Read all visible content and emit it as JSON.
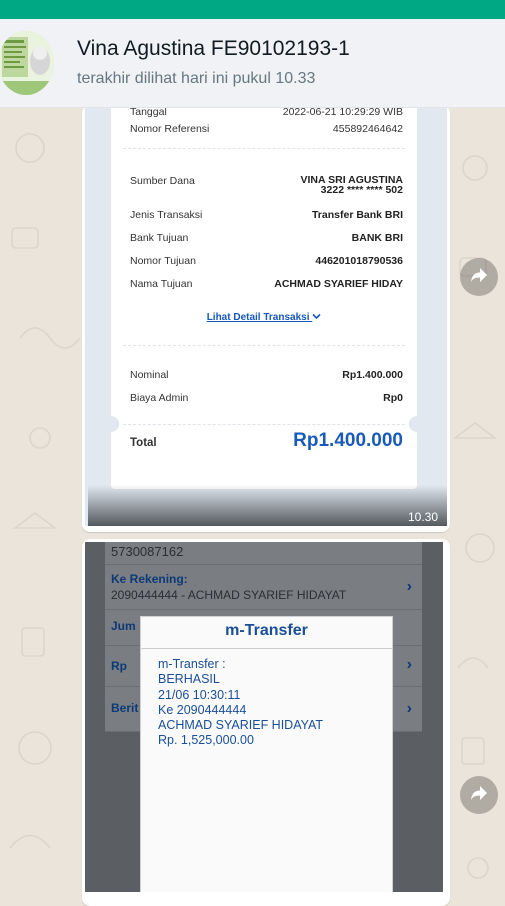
{
  "chat_header": {
    "contact_name": "Vina Agustina FE90102193-1",
    "last_seen": "terakhir dilihat hari ini pukul 10.33"
  },
  "messages": [
    {
      "type": "image",
      "time": "10.30",
      "receipt": {
        "tanggal_label": "Tanggal",
        "tanggal_value": "2022-06-21 10:29:29 WIB",
        "ref_label": "Nomor Referensi",
        "ref_value": "455892464642",
        "sumber_label": "Sumber Dana",
        "sumber_name": "VINA SRI AGUSTINA",
        "sumber_account": "3222 **** **** 502",
        "jenis_label": "Jenis Transaksi",
        "jenis_value": "Transfer Bank BRI",
        "bank_label": "Bank Tujuan",
        "bank_value": "BANK BRI",
        "nomor_label": "Nomor Tujuan",
        "nomor_value": "446201018790536",
        "nama_label": "Nama Tujuan",
        "nama_value": "ACHMAD SYARIEF HIDAY",
        "detail_link": "Lihat Detail Transaksi",
        "nominal_label": "Nominal",
        "nominal_value": "Rp1.400.000",
        "admin_label": "Biaya Admin",
        "admin_value": "Rp0",
        "total_label": "Total",
        "total_value": "Rp1.400.000"
      }
    },
    {
      "type": "image",
      "bank_screen": {
        "from_account": "5730087162",
        "ke_rekening_label": "Ke Rekening:",
        "ke_rekening_value": "2090444444 - ACHMAD SYARIEF HIDAYAT",
        "jumlah_label": "Jum",
        "rp_label": "Rp",
        "berita_label": "Berit"
      },
      "dialog": {
        "title": "m-Transfer",
        "lines": [
          "m-Transfer :",
          "BERHASIL",
          "21/06 10:30:11",
          "Ke 2090444444",
          "ACHMAD SYARIEF HIDAYAT",
          "Rp. 1,525,000.00"
        ]
      }
    }
  ],
  "colors": {
    "topbar": "#00a884",
    "header_bg": "#f0f2f5",
    "chat_bg": "#ebe4da",
    "total_blue": "#1a5ab8",
    "dialog_blue": "#1a4f98"
  },
  "icons": {
    "forward": "forward-arrow-icon",
    "chevron": "chevron-down-icon"
  }
}
